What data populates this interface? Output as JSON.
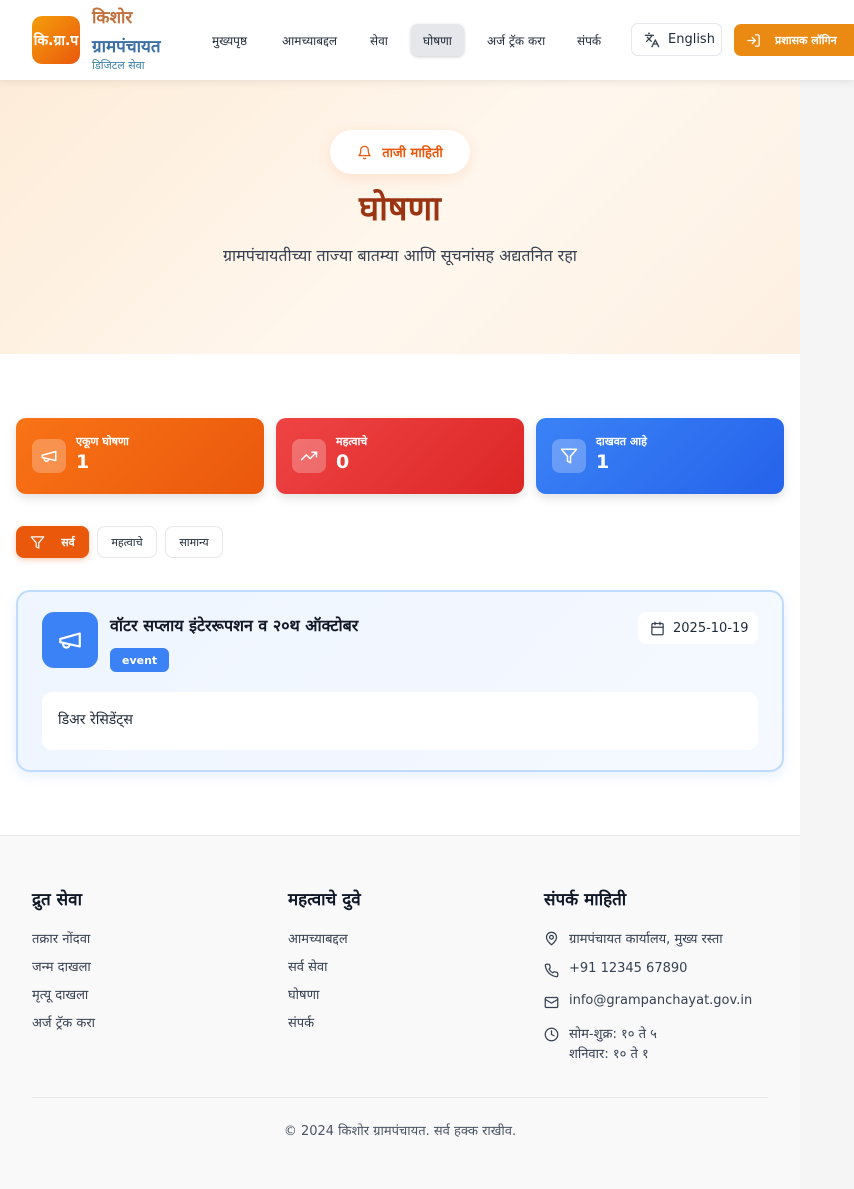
{
  "header": {
    "logo_text": "कि.ग्रा.प",
    "brand_line1": "किशोर",
    "brand_line2": "ग्रामपंचायत",
    "brand_sub": "डिजिटल सेवा",
    "nav": [
      "मुख्यपृष्ठ",
      "आमच्याबद्दल",
      "सेवा",
      "घोषणा",
      "अर्ज ट्रॅक करा",
      "संपर्क"
    ],
    "active_nav": "घोषणा",
    "language_label": "English",
    "login_label": "प्रशासक लॉगिन"
  },
  "hero": {
    "badge": "ताजी माहिती",
    "title": "घोषणा",
    "subtitle": "ग्रामपंचायतीच्या ताज्या बातम्या आणि सूचनांसह अद्यतनित रहा"
  },
  "stats": [
    {
      "label": "एकूण घोषणा",
      "value": "1",
      "icon": "megaphone-icon"
    },
    {
      "label": "महत्वाचे",
      "value": "0",
      "icon": "trending-up-icon"
    },
    {
      "label": "दाखवत आहे",
      "value": "1",
      "icon": "filter-icon"
    }
  ],
  "filters": {
    "all": "सर्व",
    "important": "महत्वाचे",
    "general": "सामान्य"
  },
  "announcement": {
    "title": "वॉटर सप्लाय इंटेररूपशन व २०थ ऑक्टोबर",
    "tag": "event",
    "date": "2025-10-19",
    "body": "डिअर रेसिडेंट्स"
  },
  "footer": {
    "quick_title": "द्रुत सेवा",
    "quick_links": [
      "तक्रार नोंदवा",
      "जन्म दाखला",
      "मृत्यू दाखला",
      "अर्ज ट्रॅक करा"
    ],
    "links_title": "महत्वाचे दुवे",
    "links": [
      "आमच्याबद्दल",
      "सर्व सेवा",
      "घोषणा",
      "संपर्क"
    ],
    "contact_title": "संपर्क माहिती",
    "address": "ग्रामपंचायत कार्यालय, मुख्य रस्ता",
    "phone": "+91 12345 67890",
    "email": "info@grampanchayat.gov.in",
    "hours_line1": "सोम-शुक्र: १० ते ५",
    "hours_line2": "शनिवार: १० ते १",
    "copyright": "© 2024 किशोर ग्रामपंचायत. सर्व हक्क राखीव."
  },
  "colors": {
    "accent": "#ea580c",
    "brand_orange": "#c2703d",
    "brand_blue": "#3b6fa6",
    "stat_orange": "#f97316",
    "stat_red": "#ef4444",
    "stat_blue": "#3b82f6"
  }
}
